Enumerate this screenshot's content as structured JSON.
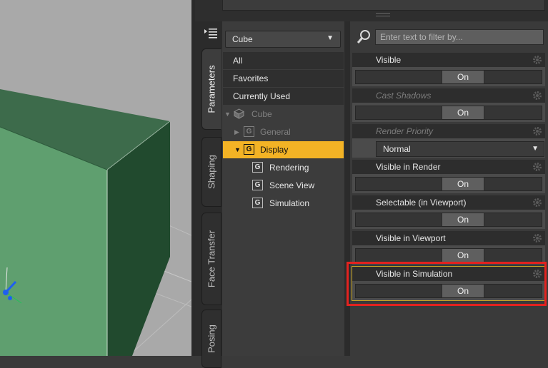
{
  "tabs": [
    {
      "label": "Parameters",
      "active": true
    },
    {
      "label": "Shaping",
      "active": false
    },
    {
      "label": "Face Transfer",
      "active": false
    },
    {
      "label": "Posing",
      "active": false
    }
  ],
  "node_select": {
    "value": "Cube"
  },
  "tree": {
    "categories": [
      "All",
      "Favorites",
      "Currently Used"
    ],
    "root": "Cube",
    "groups": [
      {
        "label": "General",
        "icon": "G"
      },
      {
        "label": "Display",
        "icon": "G"
      },
      {
        "label": "Rendering",
        "icon": "G"
      },
      {
        "label": "Scene View",
        "icon": "G"
      },
      {
        "label": "Simulation",
        "icon": "G"
      }
    ]
  },
  "filter": {
    "placeholder": "Enter text to filter by..."
  },
  "properties": [
    {
      "label": "Visible",
      "value": "On"
    },
    {
      "label": "Cast Shadows",
      "value": "On"
    },
    {
      "label": "Render Priority",
      "value": "Normal"
    },
    {
      "label": "Visible in Render",
      "value": "On"
    },
    {
      "label": "Selectable (in Viewport)",
      "value": "On"
    },
    {
      "label": "Visible in Viewport",
      "value": "On"
    },
    {
      "label": "Visible in Simulation",
      "value": "On"
    }
  ],
  "colors": {
    "selection": "#f3b325",
    "highlight_frame": "#e3221f",
    "cube_front": "#5f9f6f",
    "cube_side": "#214a2e"
  }
}
